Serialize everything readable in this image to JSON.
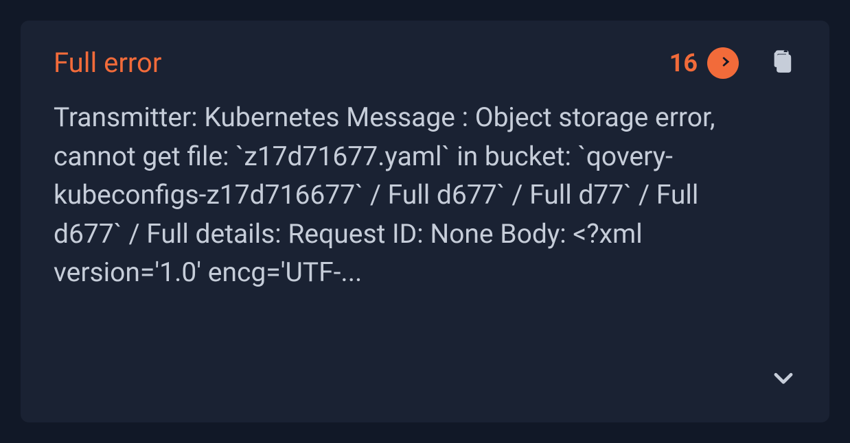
{
  "card": {
    "title": "Full error",
    "count": "16",
    "body": "Transmitter: Kubernetes Message : Object storage error, cannot get file: `z17d71677.yaml` in bucket: `qovery-kubeconfigs-z17d716677` / Full d677` / Full d77` / Full d677` / Full details: Request ID: None Body: <?xml version='1.0' encg='UTF-..."
  }
}
